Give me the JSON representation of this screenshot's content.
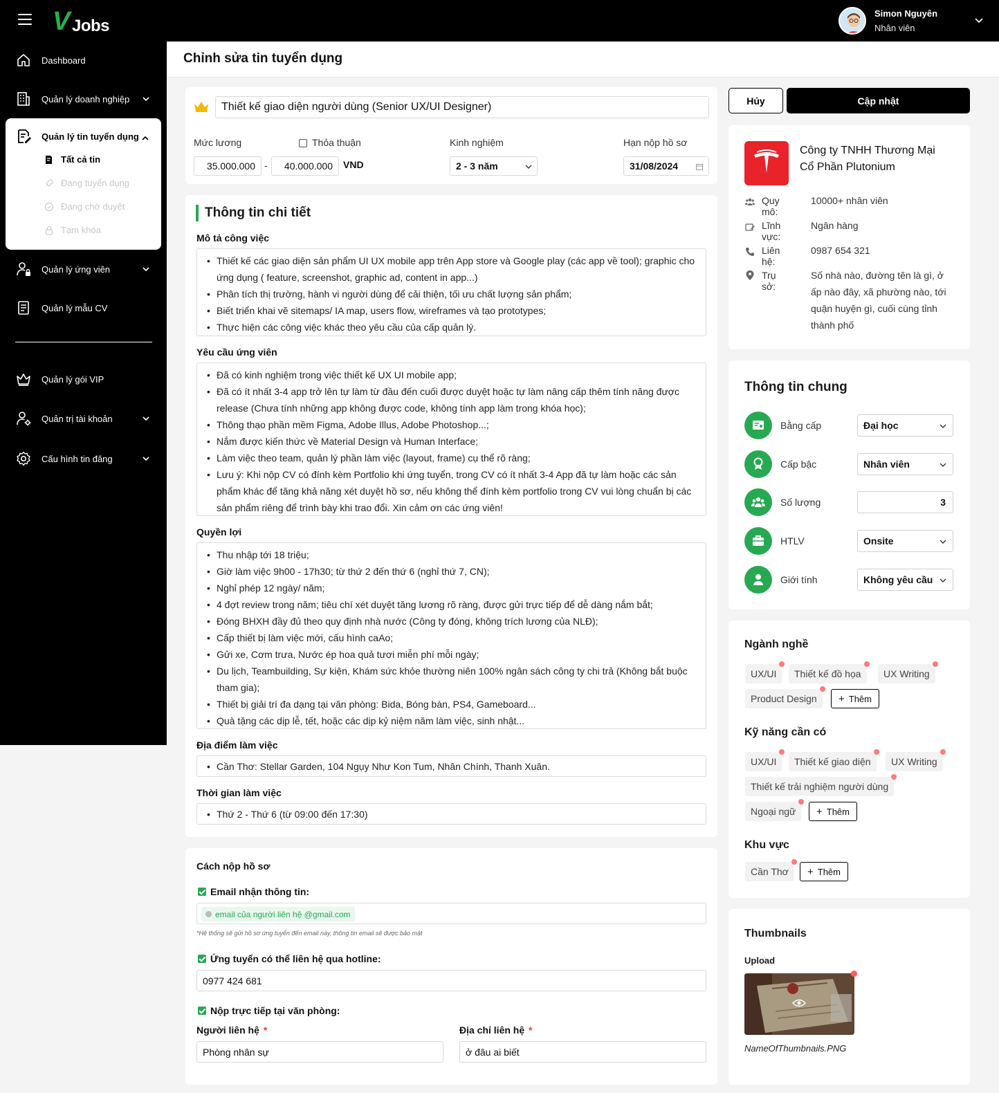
{
  "header": {
    "logo_v": "V",
    "logo_jobs": "Jobs",
    "user_name": "Simon Nguyên",
    "user_role": "Nhân viên"
  },
  "sidebar": {
    "dashboard": "Dashboard",
    "business": "Quản lý doanh nghiệp",
    "jobs": "Quản lý tin tuyển dụng",
    "sub_all": "Tất cả tin",
    "sub_hiring": "Đang tuyển dụng",
    "sub_pending": "Đang chờ duyệt",
    "sub_locked": "Tạm khóa",
    "candidates": "Quản lý ứng viên",
    "cv_templates": "Quản lý mẫu CV",
    "vip": "Quản lý gói VIP",
    "accounts": "Quản trị tài khoản",
    "config": "Cấu hình tin đăng"
  },
  "page": {
    "title": "Chỉnh sửa tin tuyển dụng"
  },
  "job": {
    "title": "Thiết kế giao diện người dùng (Senior UX/UI Designer)",
    "salary_label": "Mức lương",
    "negotiable_label": "Thỏa thuận",
    "salary_min": "35.000.000",
    "salary_sep": "-",
    "salary_max": "40.000.000",
    "currency": "VND",
    "experience_label": "Kinh nghiệm",
    "experience_value": "2 - 3 năm",
    "deadline_label": "Hạn nộp hồ sơ",
    "deadline_value": "31/08/2024"
  },
  "details": {
    "title": "Thông tin chi tiết",
    "desc_title": "Mô tả công việc",
    "desc": [
      "Thiết kế các giao diện sản phẩm UI UX mobile app trên App store và Google play (các app về tool); graphic cho ứng dụng ( feature, screenshot, graphic ad, content in app...)",
      "Phân tích thị trường, hành vi người dùng để cải thiện, tối ưu chất lượng sản phẩm;",
      "Biết triển khai vẽ sitemaps/ IA map, users flow, wireframes và tạo prototypes;",
      "Thực hiện các công việc khác theo yêu cầu của cấp quản lý."
    ],
    "req_title": "Yêu cầu ứng viên",
    "req": [
      "Đã có kinh nghiệm trong việc thiết kế UX UI mobile app;",
      "Đã có ít nhất 3-4 app trở lên tự làm từ đầu đến cuối được duyệt hoặc tự làm nâng cấp thêm tính năng được release (Chưa tính những app không được code, không tính app làm trong khóa học);",
      "Thông thạo phần mềm Figma, Adobe Illus, Adobe Photoshop...;",
      "Nắm được kiến thức về Material Design và Human Interface;",
      "Làm việc theo team, quản lý phần làm việc (layout, frame) cụ thể rõ ràng;",
      "Lưu ý: Khi nộp CV có đính kèm Portfolio khi ứng tuyển, trong CV có ít nhất 3-4 App đã tự làm hoặc các sản phẩm khác để tăng khả năng xét duyệt hồ sơ, nếu không thể đính kèm portfolio trong CV vui lòng chuẩn bị các sản phẩm riêng để trình bày khi trao đổi. Xin cảm ơn các ứng viên!"
    ],
    "benefit_title": "Quyền lợi",
    "benefit": [
      "Thu nhập tới 18 triệu;",
      "Giờ làm việc 9h00 - 17h30; từ thứ 2 đến thứ 6 (nghỉ thứ 7, CN);",
      "Nghỉ phép 12 ngày/ năm;",
      "4 đợt review trong năm; tiêu chí xét duyệt tăng lương rõ ràng, được gửi trực tiếp để dễ dàng nắm bắt;",
      "Đóng BHXH đầy đủ theo quy định nhà nước (Công ty đóng, không trích lương của NLĐ);",
      "Cấp thiết bị làm việc mới, cấu hình caAo;",
      "Gửi xe, Cơm trưa, Nước ép hoa quả tươi miễn phí mỗi ngày;",
      "Du lịch, Teambuilding, Sự kiện, Khám sức khỏe thường niên 100% ngân sách công ty chi trả (Không bắt buộc tham gia);",
      "Thiết bị giải trí đa dạng tại văn phòng: Bida, Bóng bàn, PS4, Gameboard...",
      "Quà tặng các dịp lễ, tết, hoặc các dịp kỷ niệm năm làm việc, sinh nhật..."
    ],
    "location_title": "Địa điểm làm việc",
    "location": [
      "Cần Thơ: Stellar Garden, 104 Ngụy Như Kon Tum, Nhân Chính, Thanh Xuân."
    ],
    "time_title": "Thời gian làm việc",
    "time": [
      "Thứ 2 - Thứ 6 (từ 09:00 đến 17:30)"
    ]
  },
  "apply": {
    "title": "Cách nộp hồ sơ",
    "email_label": "Email nhận thông tin:",
    "email_chip": "email của người liên hệ @gmail.com",
    "email_note": "*Hệ thống sẽ gửi hồ sơ ứng tuyển đến email này, thông tin email sẽ được bảo mật",
    "hotline_label": "Ứng tuyển có thể liên hệ qua hotline:",
    "hotline_value": "0977 424 681",
    "office_label": "Nộp trực tiếp tại văn phòng:",
    "contact_person_label": "Người liên hệ",
    "contact_person_value": "Phòng nhân sự",
    "contact_address_label": "Địa chỉ liên hệ",
    "contact_address_value": "ở đâu ai biết",
    "required_mark": "*"
  },
  "actions": {
    "cancel": "Hủy",
    "update": "Cập nhật"
  },
  "company": {
    "name": "Công ty TNHH Thương Mại Cổ Phần Plutonium",
    "size_label": "Quy mô:",
    "size_value": "10000+ nhân viên",
    "field_label": "Lĩnh vực:",
    "field_value": "Ngân hàng",
    "phone_label": "Liên hệ:",
    "phone_value": "0987 654 321",
    "address_label": "Trụ sở:",
    "address_value": "Số nhà nào, đường tên là gì, ở ấp nào đây, xã phường nào, tới quận huyện gì, cuối cùng tỉnh thành phố",
    "brand_color": "#e8232a"
  },
  "general": {
    "title": "Thông tin chung",
    "degree_label": "Bằng cấp",
    "degree_value": "Đại học",
    "level_label": "Cấp bậc",
    "level_value": "Nhân viên",
    "quantity_label": "Số lượng",
    "quantity_value": "3",
    "worktype_label": "HTLV",
    "worktype_value": "Onsite",
    "gender_label": "Giới tính",
    "gender_value": "Không yêu cầu",
    "accent": "#27a952"
  },
  "industries": {
    "title": "Ngành nghề",
    "tags": [
      "UX/UI",
      "Thiết kế đồ họa",
      "UX Writing",
      "Product Design"
    ],
    "add": "Thêm"
  },
  "skills": {
    "title": "Kỹ năng cần có",
    "tags": [
      "UX/UI",
      "Thiết kế giao diện",
      "UX Writing",
      "Thiết kế trải nghiệm người dùng",
      "Ngoại ngữ"
    ],
    "add": "Thêm"
  },
  "regions": {
    "title": "Khu vực",
    "tags": [
      "Cần Thơ"
    ],
    "add": "Thêm"
  },
  "thumbnails": {
    "title": "Thumbnails",
    "upload_label": "Upload",
    "file_name": "NameOfThumbnails.PNG"
  }
}
